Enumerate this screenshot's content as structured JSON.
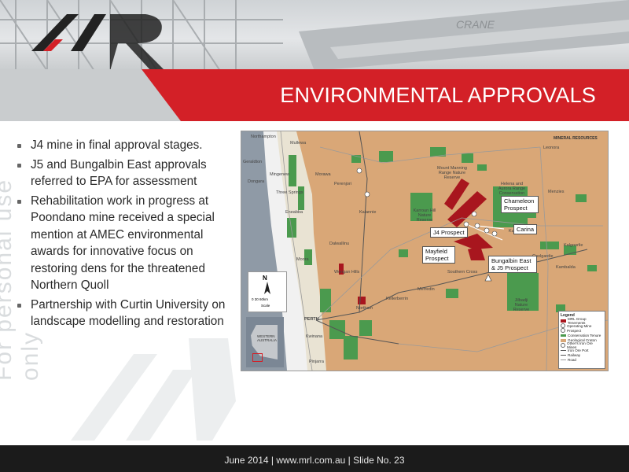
{
  "slide": {
    "title": "ENVIRONMENTAL APPROVALS",
    "watermark": "For personal use only",
    "banner_text": "CRANE",
    "bullets": [
      "J4 mine in final approval stages.",
      "J5 and Bungalbin East approvals referred to EPA for assessment",
      "Rehabilitation work in progress at Poondano mine received a special mention at AMEC environmental awards for innovative focus on restoring dens for the threatened Northern Quoll",
      "Partnership with Curtin University on landscape modelling and restoration"
    ],
    "footer": "June 2014   |   www.mrl.com.au   |   Slide No. 23"
  },
  "map": {
    "logo": "MINERAL RESOURCES",
    "inset_label": "WESTERN AUSTRALIA",
    "scale_label": "0   30   60km",
    "scale_sub": "Scale",
    "compass_label": "N",
    "callouts": {
      "chameleon": "Chameleon Prospect",
      "carina": "Carina",
      "j4": "J4 Prospect",
      "mayfield": "Mayfield Prospect",
      "bungalbin": "Bungalbin East & J5 Prospect"
    },
    "place_labels": {
      "northampton": "Northampton",
      "mullewa": "Mullewa",
      "geraldton": "Geraldton",
      "mingenew": "Mingenew",
      "morawa": "Morawa",
      "dongara": "Dongara",
      "three_springs": "Three Springs",
      "eneabba": "Eneabba",
      "perenjori": "Perenjori",
      "dalwallinu": "Dalwallinu",
      "kalannie": "Kalannie",
      "moora": "Moora",
      "wongan_hills": "Wongan Hills",
      "kellerberrin": "Kellerberrin",
      "northam": "Northam",
      "perth": "PERTH",
      "kwinana": "Kwinana",
      "pinjarra": "Pinjarra",
      "merredin": "Merredin",
      "southern_cross": "Southern Cross",
      "coolgardie": "Coolgardie",
      "kalgoorlie": "Kalgoorlie",
      "kambalda": "Kambalda",
      "menzies": "Menzies",
      "leonora": "Leonora",
      "kurrajong": "Kurrajong",
      "mt_manning": "Mount Manning Range Nature Reserve",
      "helena_aurora": "Helena and Aurora Range Conservation Park",
      "karroun_hill": "Karroun Hill Nature Reserve",
      "jilbadji": "Jilbadji Nature Reserve"
    },
    "legend": {
      "title": "Legend",
      "items": [
        {
          "label": "MRL Group Tenements",
          "color": "#a8161e"
        },
        {
          "label": "Operating Mine",
          "color": "#9b9b9b"
        },
        {
          "label": "Prospect",
          "color": "#9b9b9b"
        },
        {
          "label": "Conservation Tenure",
          "color": "#4b9a4e"
        },
        {
          "label": "Geological Craton",
          "color": "#d9a777"
        },
        {
          "label": "Other's Iron Ore Mines",
          "color": "#9b9b9b"
        },
        {
          "label": "Iron Ore Port",
          "color": "#555555"
        },
        {
          "label": "Railway",
          "color": "#555555"
        },
        {
          "label": "Road",
          "color": "#9a9a9a"
        }
      ]
    }
  },
  "colors": {
    "accent": "#d32027",
    "craton": "#d9a777",
    "conservation": "#4b9a4e",
    "tenement": "#a8161e",
    "footer_bg": "#1b1b1b"
  }
}
